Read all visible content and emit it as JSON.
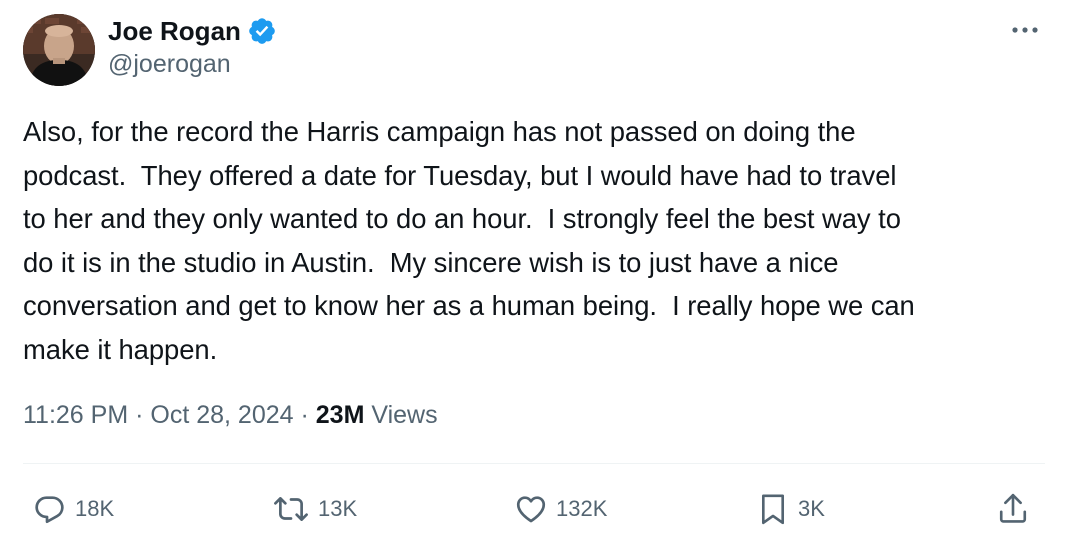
{
  "author": {
    "display_name": "Joe Rogan",
    "handle": "@joerogan",
    "verified": true,
    "badge_color": "#1d9bf0"
  },
  "tweet": {
    "text": "Also, for the record the Harris campaign has not passed on doing the\npodcast.  They offered a date for Tuesday, but I would have had to travel\nto her and they only wanted to do an hour.  I strongly feel the best way to\ndo it is in the studio in Austin.  My sincere wish is to just have a nice\nconversation and get to know her as a human being.  I really hope we can\nmake it happen."
  },
  "meta": {
    "time": "11:26 PM",
    "separator": "·",
    "date": "Oct 28, 2024",
    "views_count": "23M",
    "views_label": "Views"
  },
  "actions": {
    "replies": "18K",
    "reposts": "13K",
    "likes": "132K",
    "bookmarks": "3K"
  },
  "icons": {
    "more": "more-horizontal-icon",
    "reply": "reply-icon",
    "repost": "repost-icon",
    "like": "heart-icon",
    "bookmark": "bookmark-icon",
    "share": "share-icon",
    "verified": "verified-badge-icon"
  },
  "colors": {
    "text_primary": "#0f1419",
    "text_secondary": "#536471",
    "divider": "#eff3f4",
    "accent": "#1d9bf0"
  }
}
